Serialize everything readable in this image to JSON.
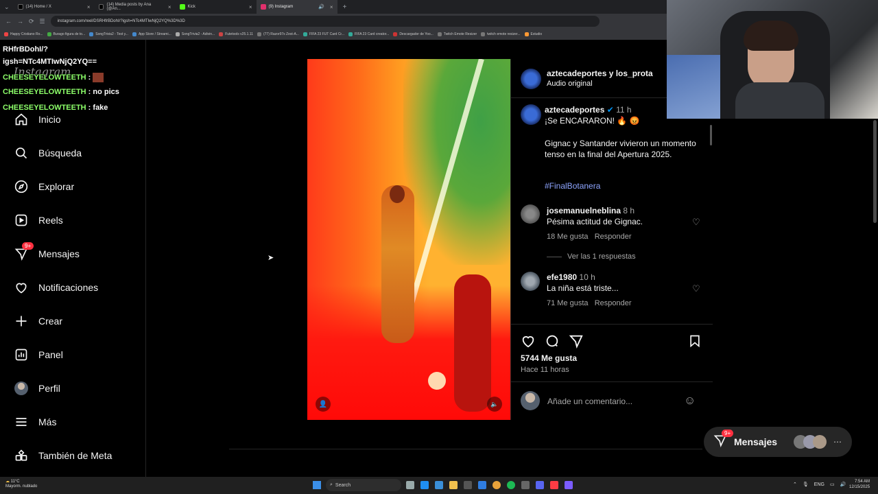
{
  "browser": {
    "tabs": [
      {
        "label": "(14) Home / X",
        "color": "#000000"
      },
      {
        "label": "(14) Media posts by Ana (@An...",
        "color": "#000000"
      },
      {
        "label": "Kick",
        "color": "#53fc18"
      },
      {
        "label": "(9) Instagram",
        "color": "#e1306c",
        "active": true
      }
    ],
    "url": "instagram.com/reel/DSRHfrBDohI/?igsh=NTc4MTIwNjQ2YQ%3D%3D",
    "bookmarks": [
      "Happy Cristiano Ro...",
      "Burago figura de to...",
      "SongTrivia2 - Test y...",
      "App Store / Streami...",
      "SongTrivia2 - Adivin...",
      "Futetools v25.1.11",
      "(77) Razor97s Zest-A...",
      "FIFA 23 FUT Card Cr...",
      "FIFA 23 Card creator...",
      "Descargador de Yoo...",
      "Twitch Emote Resizer",
      "twitch emote resizer...",
      "Estudio"
    ]
  },
  "chat": {
    "url_line1": "RHfrBDohI/?",
    "url_line2": "igsh=NTc4MTIwNjQ2YQ==",
    "messages": [
      {
        "user": "CHEESEYELOWTEETH",
        "text": ""
      },
      {
        "user": "CHEESEYELOWTEETH",
        "text": "no pics"
      },
      {
        "user": "CHEESEYELOWTEETH",
        "text": "fake"
      }
    ],
    "logo_text": "Instagram"
  },
  "sidebar": {
    "items": [
      {
        "label": "Inicio",
        "icon": "home-icon"
      },
      {
        "label": "Búsqueda",
        "icon": "search-icon"
      },
      {
        "label": "Explorar",
        "icon": "compass-icon"
      },
      {
        "label": "Reels",
        "icon": "reels-icon"
      },
      {
        "label": "Mensajes",
        "icon": "messenger-icon",
        "badge": "9+"
      },
      {
        "label": "Notificaciones",
        "icon": "heart-icon"
      },
      {
        "label": "Crear",
        "icon": "plus-icon"
      },
      {
        "label": "Panel",
        "icon": "chart-icon"
      },
      {
        "label": "Perfil",
        "icon": "avatar"
      },
      {
        "label": "Más",
        "icon": "menu-icon"
      },
      {
        "label": "También de Meta",
        "icon": "meta-apps-icon"
      }
    ]
  },
  "post": {
    "header_user": "aztecadeportes y los_prota",
    "header_sub": "Audio original",
    "caption_user": "aztecadeportes",
    "caption_time": "11 h",
    "caption_line1": "¡Se ENCARARON! 🔥 😡",
    "caption_body": "Gignac y Santander vivieron un momento tenso en la final del Apertura 2025.",
    "hashtag": "#FinalBotanera",
    "comments": [
      {
        "user": "josemanuelneblina",
        "time": "8 h",
        "text": "Pésima actitud de Gignac.",
        "likes": "18 Me gusta",
        "reply": "Responder",
        "view_replies": "Ver las 1 respuestas"
      },
      {
        "user": "efe1980",
        "time": "10 h",
        "text": "La niña está triste...",
        "likes": "71 Me gusta",
        "reply": "Responder"
      }
    ],
    "likes": "5744 Me gusta",
    "time_ago": "Hace 11 horas",
    "comment_placeholder": "Añade un comentario..."
  },
  "messages_pill": {
    "label": "Mensajes",
    "badge": "9+"
  },
  "taskbar": {
    "weather_temp": "11°C",
    "weather_desc": "Mayorm. nublado",
    "search": "Search",
    "lang": "ENG",
    "time": "7:54 AM",
    "date": "12/15/2025"
  },
  "colors": {
    "accent_link": "#8ea5ff",
    "verified": "#0095f6",
    "badge": "#ff3040"
  }
}
